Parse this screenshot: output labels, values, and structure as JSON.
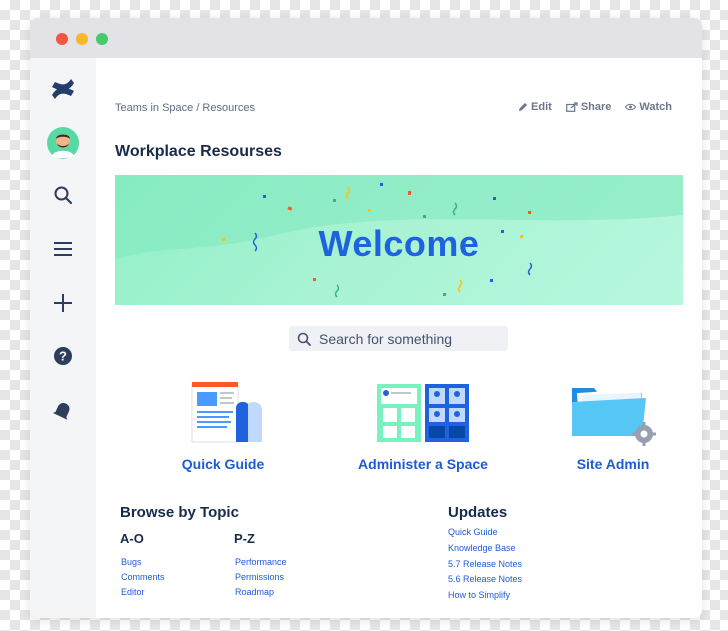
{
  "window": {
    "controls": [
      "close",
      "minimize",
      "zoom"
    ],
    "colors": {
      "close": "#f3563f",
      "minimize": "#f7b72a",
      "zoom": "#44c96d"
    }
  },
  "sidebar": {
    "items": [
      {
        "icon": "confluence-logo-icon"
      },
      {
        "icon": "user-avatar"
      },
      {
        "icon": "search-icon"
      },
      {
        "icon": "menu-icon"
      },
      {
        "icon": "plus-icon"
      },
      {
        "icon": "help-icon"
      },
      {
        "icon": "notification-bell-icon"
      }
    ]
  },
  "header": {
    "breadcrumb": "Teams in Space / Resources",
    "actions": [
      {
        "label": "Edit",
        "icon": "pencil-icon"
      },
      {
        "label": "Share",
        "icon": "share-icon"
      },
      {
        "label": "Watch",
        "icon": "eye-icon"
      }
    ]
  },
  "page": {
    "title": "Workplace Resourses",
    "banner_text": "Welcome",
    "accent_color": "#1f62e0",
    "banner_color": "#a8f3d3"
  },
  "search": {
    "placeholder": "Search for something"
  },
  "cards": [
    {
      "label": "Quick Guide",
      "icon": "document-guide-icon"
    },
    {
      "label": "Administer a Space",
      "icon": "space-dashboard-icon"
    },
    {
      "label": "Site Admin",
      "icon": "folder-settings-icon"
    }
  ],
  "browse": {
    "title": "Browse by Topic",
    "columns": [
      {
        "heading": "A-O",
        "links": [
          "Bugs",
          "Comments",
          "Editor"
        ]
      },
      {
        "heading": "P-Z",
        "links": [
          "Performance",
          "Permissions",
          "Roadmap"
        ]
      }
    ]
  },
  "updates": {
    "title": "Updates",
    "links": [
      "Quick Guide",
      "Knowledge Base",
      "5.7 Release Notes",
      "5.6 Release Notes",
      "How to Simplify"
    ]
  }
}
